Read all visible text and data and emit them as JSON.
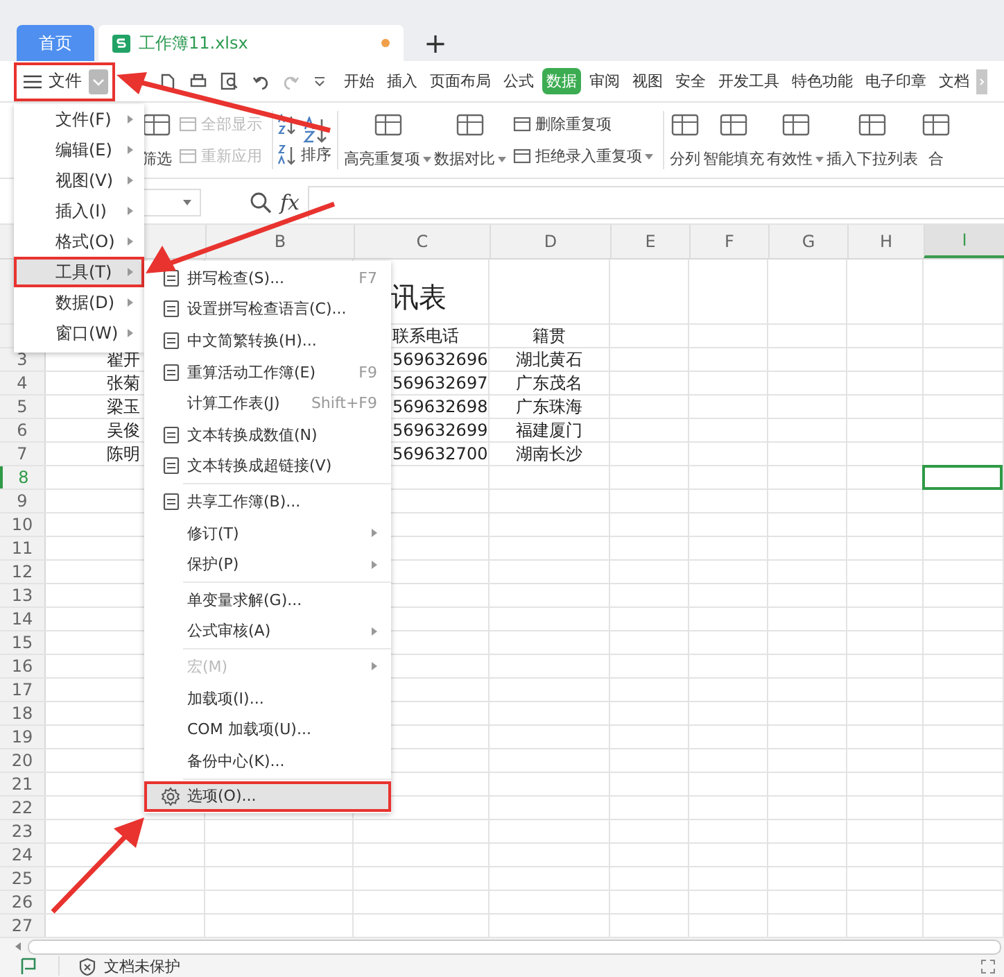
{
  "doc_tabs": [
    {
      "label": "首页",
      "kind": "home",
      "selected": false
    },
    {
      "label": "工作簿11.xlsx",
      "kind": "sheet",
      "selected": true,
      "modified": true
    }
  ],
  "new_tab": "+",
  "file_menu_button": {
    "label": "文件",
    "highlighted": true
  },
  "menu_tabs": [
    {
      "label": "开始",
      "selected": false
    },
    {
      "label": "插入",
      "selected": false
    },
    {
      "label": "页面布局",
      "selected": false
    },
    {
      "label": "公式",
      "selected": false
    },
    {
      "label": "数据",
      "selected": true
    },
    {
      "label": "审阅",
      "selected": false
    },
    {
      "label": "视图",
      "selected": false
    },
    {
      "label": "安全",
      "selected": false
    },
    {
      "label": "开发工具",
      "selected": false
    },
    {
      "label": "特色功能",
      "selected": false
    },
    {
      "label": "电子印章",
      "selected": false
    },
    {
      "label": "文档",
      "selected": false
    }
  ],
  "ribbon": [
    {
      "kind": "large",
      "label": "筛选",
      "dropdown": false
    },
    {
      "kind": "stack",
      "items": [
        {
          "label": "全部显示",
          "disabled": true,
          "dropdown": false
        },
        {
          "label": "重新应用",
          "disabled": true,
          "dropdown": false
        }
      ]
    },
    {
      "kind": "separator"
    },
    {
      "kind": "sort",
      "label": "排序"
    },
    {
      "kind": "separator"
    },
    {
      "kind": "large",
      "label": "高亮重复项",
      "dropdown": true
    },
    {
      "kind": "large",
      "label": "数据对比",
      "dropdown": true
    },
    {
      "kind": "stack",
      "items": [
        {
          "label": "删除重复项",
          "disabled": false,
          "dropdown": false
        },
        {
          "label": "拒绝录入重复项",
          "disabled": false,
          "dropdown": true
        }
      ]
    },
    {
      "kind": "separator"
    },
    {
      "kind": "large",
      "label": "分列",
      "dropdown": false
    },
    {
      "kind": "large",
      "label": "智能填充",
      "dropdown": false
    },
    {
      "kind": "large",
      "label": "有效性",
      "dropdown": true
    },
    {
      "kind": "large",
      "label": "插入下拉列表",
      "dropdown": false
    },
    {
      "kind": "large",
      "label": "合",
      "dropdown": false
    }
  ],
  "formula_bar": {
    "fx": "fx"
  },
  "sheet": {
    "columns": [
      {
        "label": "B",
        "selected": false
      },
      {
        "label": "C",
        "selected": false
      },
      {
        "label": "D",
        "selected": false
      },
      {
        "label": "E",
        "selected": false
      },
      {
        "label": "F",
        "selected": false
      },
      {
        "label": "G",
        "selected": false
      },
      {
        "label": "H",
        "selected": false
      },
      {
        "label": "I",
        "selected": true
      }
    ],
    "rows": [
      {
        "selected": false,
        "title": "讯表"
      },
      {
        "selected": false,
        "phone": "联系电话",
        "hometown": "籍贯"
      },
      {
        "label": "3",
        "selected": false,
        "name": "翟开",
        "phone": "569632696",
        "hometown": "湖北黄石"
      },
      {
        "label": "4",
        "selected": false,
        "name": "张菊",
        "phone": "569632697",
        "hometown": "广东茂名"
      },
      {
        "label": "5",
        "selected": false,
        "name": "梁玉",
        "phone": "569632698",
        "hometown": "广东珠海"
      },
      {
        "label": "6",
        "selected": false,
        "name": "吴俊",
        "phone": "569632699",
        "hometown": "福建厦门"
      },
      {
        "label": "7",
        "selected": false,
        "name": "陈明",
        "phone": "569632700",
        "hometown": "湖南长沙"
      },
      {
        "label": "8",
        "selected": true
      },
      {
        "label": "9",
        "selected": false
      },
      {
        "label": "10",
        "selected": false
      },
      {
        "label": "11",
        "selected": false
      },
      {
        "label": "12",
        "selected": false
      },
      {
        "label": "13",
        "selected": false
      },
      {
        "label": "14",
        "selected": false
      },
      {
        "label": "15",
        "selected": false
      },
      {
        "label": "16",
        "selected": false
      },
      {
        "label": "17",
        "selected": false
      },
      {
        "label": "18",
        "selected": false
      },
      {
        "label": "19",
        "selected": false
      },
      {
        "label": "20",
        "selected": false
      },
      {
        "label": "21",
        "selected": false
      },
      {
        "label": "22",
        "selected": false
      },
      {
        "label": "23",
        "selected": false
      },
      {
        "label": "24",
        "selected": false
      },
      {
        "label": "25",
        "selected": false
      },
      {
        "label": "26",
        "selected": false
      },
      {
        "label": "27",
        "selected": false
      }
    ]
  },
  "file_menu": [
    {
      "label": "文件(F)",
      "selected": false
    },
    {
      "label": "编辑(E)",
      "selected": false
    },
    {
      "label": "视图(V)",
      "selected": false
    },
    {
      "label": "插入(I)",
      "selected": false
    },
    {
      "label": "格式(O)",
      "selected": false
    },
    {
      "label": "工具(T)",
      "selected": true
    },
    {
      "label": "数据(D)",
      "selected": false
    },
    {
      "label": "窗口(W)",
      "selected": false
    }
  ],
  "tools_menu": [
    {
      "kind": "icon",
      "label": "拼写检查(S)...",
      "shortcut": "F7",
      "submenu": false,
      "disabled": false,
      "selected": false,
      "separator_before": false
    },
    {
      "kind": "icon",
      "label": "设置拼写检查语言(C)...",
      "submenu": false,
      "disabled": false,
      "selected": false,
      "separator_before": false
    },
    {
      "kind": "icon",
      "label": "中文简繁转换(H)...",
      "submenu": false,
      "disabled": false,
      "selected": false,
      "separator_before": false
    },
    {
      "kind": "icon",
      "label": "重算活动工作簿(E)",
      "shortcut": "F9",
      "submenu": false,
      "disabled": false,
      "selected": false,
      "separator_before": false
    },
    {
      "kind": "plain",
      "label": "计算工作表(J)",
      "shortcut": "Shift+F9",
      "submenu": false,
      "disabled": false,
      "selected": false,
      "separator_before": false
    },
    {
      "kind": "icon",
      "label": "文本转换成数值(N)",
      "submenu": false,
      "disabled": false,
      "selected": false,
      "separator_before": false
    },
    {
      "kind": "icon",
      "label": "文本转换成超链接(V)",
      "submenu": false,
      "disabled": false,
      "selected": false,
      "separator_before": false
    },
    {
      "kind": "icon",
      "label": "共享工作簿(B)...",
      "submenu": false,
      "disabled": false,
      "selected": false,
      "separator_before": true
    },
    {
      "kind": "plain",
      "label": "修订(T)",
      "submenu": true,
      "disabled": false,
      "selected": false,
      "separator_before": false
    },
    {
      "kind": "plain",
      "label": "保护(P)",
      "submenu": true,
      "disabled": false,
      "selected": false,
      "separator_before": false
    },
    {
      "kind": "plain",
      "label": "单变量求解(G)...",
      "submenu": false,
      "disabled": false,
      "selected": false,
      "separator_before": true
    },
    {
      "kind": "plain",
      "label": "公式审核(A)",
      "submenu": true,
      "disabled": false,
      "selected": false,
      "separator_before": false
    },
    {
      "kind": "plain",
      "label": "宏(M)",
      "submenu": true,
      "disabled": true,
      "selected": false,
      "separator_before": true
    },
    {
      "kind": "plain",
      "label": "加载项(I)...",
      "submenu": false,
      "disabled": false,
      "selected": false,
      "separator_before": false
    },
    {
      "kind": "plain",
      "label": "COM 加载项(U)...",
      "submenu": false,
      "disabled": false,
      "selected": false,
      "separator_before": false
    },
    {
      "kind": "plain",
      "label": "备份中心(K)...",
      "submenu": false,
      "disabled": false,
      "selected": false,
      "separator_before": false
    },
    {
      "kind": "gear",
      "label": "选项(O)...",
      "submenu": false,
      "disabled": false,
      "selected": true,
      "separator_before": true
    }
  ],
  "status_bar": {
    "protection": "文档未保护"
  }
}
